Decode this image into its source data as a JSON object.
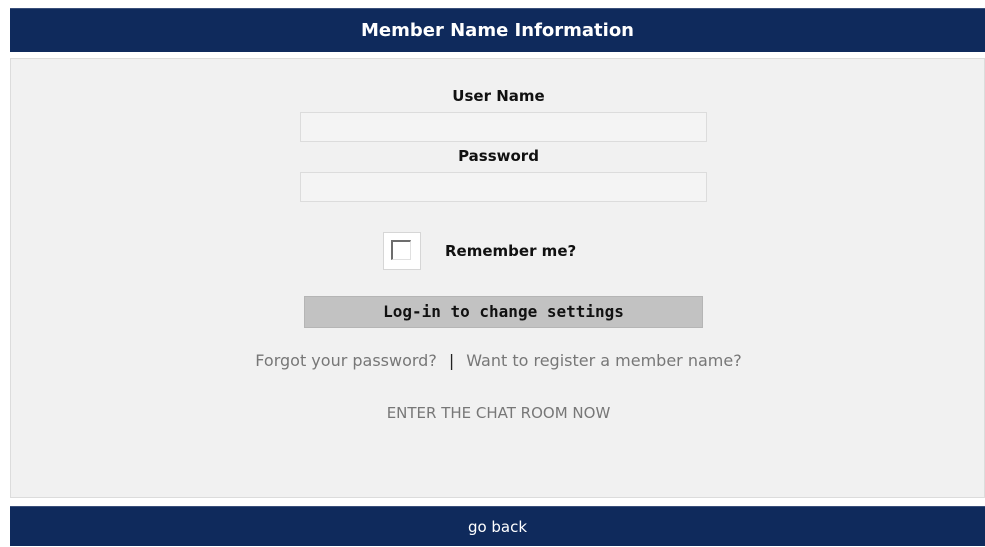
{
  "header": {
    "title": "Member Name Information"
  },
  "form": {
    "username_label": "User Name",
    "username_value": "",
    "password_label": "Password",
    "password_value": "",
    "remember_label": "Remember me?",
    "remember_checked": false,
    "submit_label": "Log-in to change settings"
  },
  "links": {
    "forgot": "Forgot your password?",
    "separator": "|",
    "register": "Want to register a member name?",
    "chat_room": "ENTER THE CHAT ROOM NOW"
  },
  "footer": {
    "back_label": "go back"
  },
  "colors": {
    "header_bg": "#0f2a5c",
    "panel_bg": "#f1f1f1",
    "button_bg": "#c2c2c2",
    "link_text": "#777777"
  }
}
